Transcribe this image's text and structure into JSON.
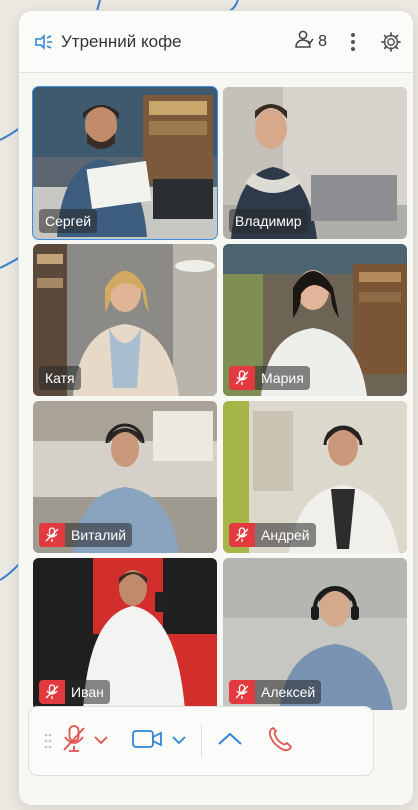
{
  "header": {
    "title": "Утренний кофе",
    "participants_count": "8"
  },
  "participants": [
    {
      "name": "Сергей",
      "muted": false,
      "active": true
    },
    {
      "name": "Владимир",
      "muted": false,
      "active": false
    },
    {
      "name": "Катя",
      "muted": false,
      "active": false
    },
    {
      "name": "Мария",
      "muted": true,
      "active": false
    },
    {
      "name": "Виталий",
      "muted": true,
      "active": false
    },
    {
      "name": "Андрей",
      "muted": true,
      "active": false
    },
    {
      "name": "Иван",
      "muted": true,
      "active": false
    },
    {
      "name": "Алексей",
      "muted": true,
      "active": false
    }
  ],
  "controls": {
    "icons": [
      "mic-off-icon",
      "chevron-down-icon",
      "camera-icon",
      "chevron-down-icon",
      "chevron-up-icon",
      "hang-up-icon"
    ]
  },
  "colors": {
    "accent": "#3c8fe0",
    "mute_red": "#e23a3f",
    "control_red": "#e0534f",
    "control_blue": "#2f86d6"
  }
}
